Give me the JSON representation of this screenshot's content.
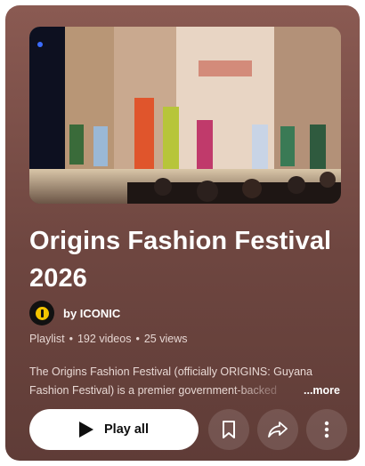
{
  "playlist": {
    "title": "Origins Fashion Festival 2026",
    "owner": "by ICONIC",
    "meta": {
      "type": "Playlist",
      "videos": "192 videos",
      "views": "25 views"
    },
    "description_line1": "The Origins Fashion Festival (officially ORIGINS: Guyana",
    "description_line2": "Fashion Festival) is a premier government-backed",
    "more_label": "...more"
  },
  "actions": {
    "play_all_label": "Play all",
    "save_icon": "bookmark-icon",
    "share_icon": "share-icon",
    "more_icon": "more-vertical-icon"
  },
  "colors": {
    "card_background": "#7a4f48",
    "button_background": "#ffffff",
    "text_primary": "#ffffff",
    "text_secondary": "#e6d6d2"
  }
}
